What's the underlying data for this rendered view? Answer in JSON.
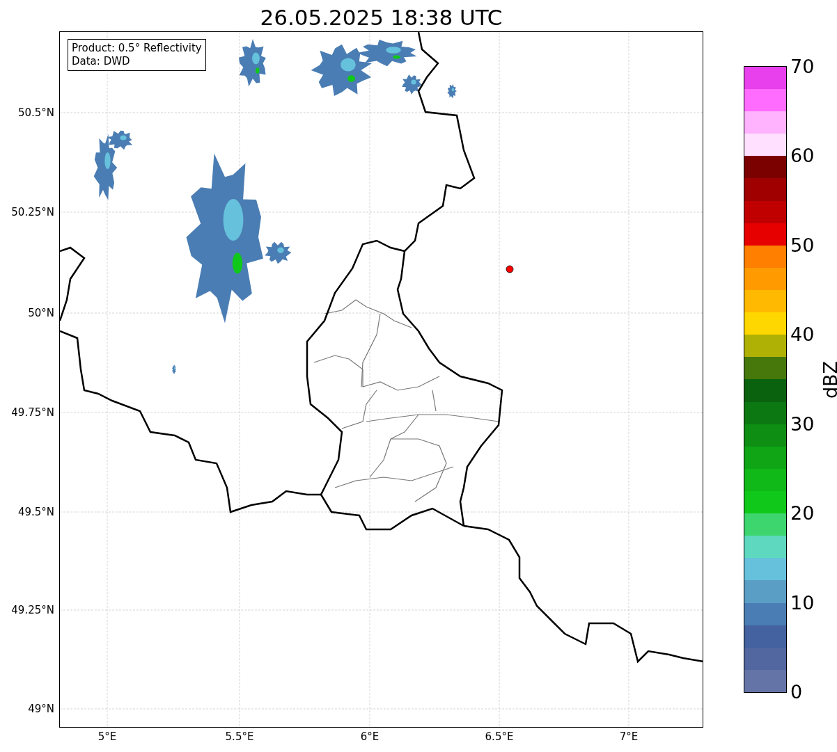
{
  "title": "26.05.2025 18:38 UTC",
  "legend": [
    "Product: 0.5° Reflectivity",
    "Data: DWD"
  ],
  "map": {
    "lat_ticks": [
      "50.5°N",
      "50.25°N",
      "50°N",
      "49.75°N",
      "49.5°N",
      "49.25°N",
      "49°N"
    ],
    "lon_ticks": [
      "5°E",
      "5.5°E",
      "6°E",
      "6.5°E",
      "7°E"
    ]
  },
  "colorbar": {
    "label": "dBZ",
    "ticks": [
      "70",
      "60",
      "50",
      "40",
      "30",
      "20",
      "10",
      "0"
    ],
    "bins": [
      {
        "color": "#6474a6"
      },
      {
        "color": "#52679f"
      },
      {
        "color": "#4461a0"
      },
      {
        "color": "#4a7db3"
      },
      {
        "color": "#5a9ec6"
      },
      {
        "color": "#66c1dc"
      },
      {
        "color": "#5fd8c0"
      },
      {
        "color": "#3dd66e"
      },
      {
        "color": "#10c819"
      },
      {
        "color": "#10b818"
      },
      {
        "color": "#10a514"
      },
      {
        "color": "#0e8f14"
      },
      {
        "color": "#0b7812"
      },
      {
        "color": "#0a620e"
      },
      {
        "color": "#46780c"
      },
      {
        "color": "#afb105"
      },
      {
        "color": "#ffd700"
      },
      {
        "color": "#ffb900"
      },
      {
        "color": "#ff9b00"
      },
      {
        "color": "#ff7f00"
      },
      {
        "color": "#e60000"
      },
      {
        "color": "#c00000"
      },
      {
        "color": "#a00000"
      },
      {
        "color": "#7b0000"
      },
      {
        "color": "#ffe0ff"
      },
      {
        "color": "#ffb3ff"
      },
      {
        "color": "#ff6cff"
      },
      {
        "color": "#e840ec"
      }
    ]
  }
}
